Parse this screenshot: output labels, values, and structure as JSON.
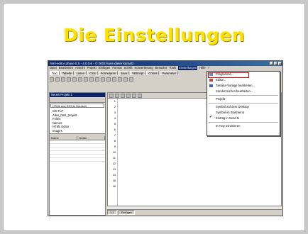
{
  "slide_title": "Die Einstellungen",
  "window": {
    "title": "html-editor phase 5.5 - 4.0.0.6 - © 2003 hans-dieter karnatz",
    "buttons": [
      "_",
      "□",
      "×"
    ]
  },
  "menubar": [
    "Datei",
    "Bearbeiten",
    "Ansicht",
    "Projekt",
    "Einfügen",
    "Format",
    "Schrift",
    "Konvertierung",
    "Benutzer",
    "Tools",
    "Einstellungen",
    "Hilfe",
    "?"
  ],
  "active_menu_index": 10,
  "tabs": [
    "Text",
    "Tabelle",
    "Listen",
    "CSS",
    "Formularen",
    "Java",
    "VBScript",
    "Colors",
    "Parameter"
  ],
  "left_panel": {
    "header": "Neues Projekt 1",
    "dropdown": "HTML und CSS in Deutsch",
    "tree": [
      "CD-TLP",
      "Alles_html_projekt",
      "Folien",
      "Names",
      "HTML Editor",
      "Images"
    ],
    "grid_cols": [
      "Name",
      "Größe"
    ]
  },
  "line_numbers": [
    "1",
    "2",
    "3",
    "4",
    "5",
    "6",
    "7",
    "8",
    "9",
    "10",
    "11",
    "12",
    "13",
    "14",
    "15",
    "16"
  ],
  "status": [
    "1:1",
    "Einfügen"
  ],
  "dropdown_menu": {
    "items": [
      "Programme...",
      "Editor...",
      "Tastatur-Vorlage bearbeiten...",
      "Sonderzeichen bearbeiten...",
      "Projekt",
      "Symbol auf dem Desktop",
      "Symbol im Startmenü",
      "Eintrag in Send to",
      "In Tray minimieren"
    ],
    "highlight_color": "#e00000"
  }
}
